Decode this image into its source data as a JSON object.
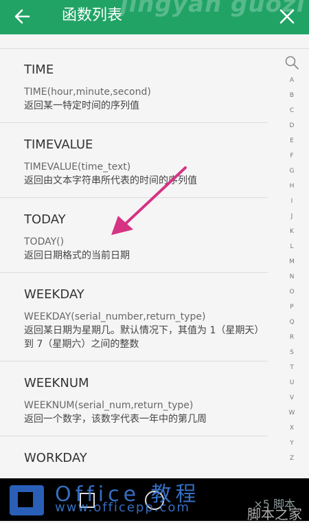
{
  "header": {
    "title": "函数列表",
    "watermark": "jingyan guozi"
  },
  "functions": [
    {
      "name": "TIME",
      "signature": "TIME(hour,minute,second)",
      "description": "返回某一特定时间的序列值"
    },
    {
      "name": "TIMEVALUE",
      "signature": "TIMEVALUE(time_text)",
      "description": "返回由文本字符串所代表的时间的序列值"
    },
    {
      "name": "TODAY",
      "signature": "TODAY()",
      "description": "返回日期格式的当前日期"
    },
    {
      "name": "WEEKDAY",
      "signature": "WEEKDAY(serial_number,return_type)",
      "description": "返回某日期为星期几。默认情况下，其值为 1（星期天）到 7（星期六）之间的整数"
    },
    {
      "name": "WEEKNUM",
      "signature": "WEEKNUM(serial_num,return_type)",
      "description": "返回一个数字，该数字代表一年中的第几周"
    },
    {
      "name": "WORKDAY",
      "signature": "",
      "description": ""
    }
  ],
  "index_letters": [
    "A",
    "B",
    "C",
    "D",
    "E",
    "F",
    "G",
    "H",
    "I",
    "J",
    "K",
    "L",
    "M",
    "N",
    "O",
    "P",
    "Q",
    "R",
    "S",
    "T",
    "U",
    "V",
    "W",
    "X",
    "Y",
    "Z"
  ],
  "watermarks": {
    "office_title": "Office 教程",
    "office_url": "www.officepp.com",
    "right_top": "×5 脚本",
    "right_bottom": "脚本之家"
  },
  "colors": {
    "appbar": "#21a366",
    "arrow": "#d63384"
  }
}
